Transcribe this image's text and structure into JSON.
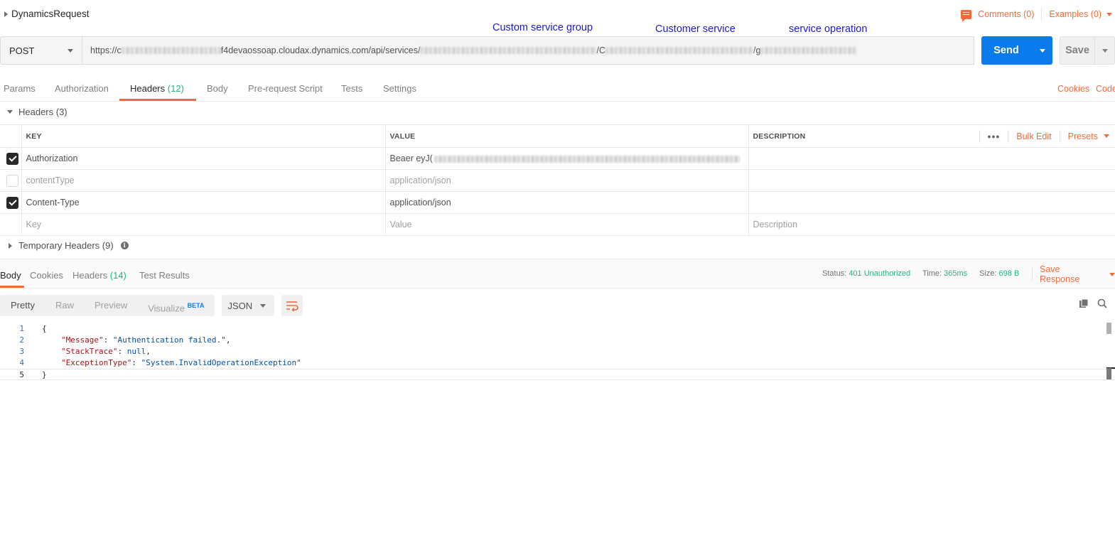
{
  "request": {
    "name": "DynamicsRequest",
    "comments_label": "Comments (0)",
    "examples_label": "Examples (0)",
    "method": "POST",
    "url_prefix": "https://c",
    "url_host_suffix": "f4devaossoap.cloudax.dynamics.com/api/services/",
    "url_sep1": "/C",
    "url_sep2": "/g",
    "send_label": "Send",
    "save_label": "Save"
  },
  "annotations": {
    "group": "Custom service group",
    "service": "Customer service",
    "operation": "service operation"
  },
  "request_tabs": {
    "params": "Params",
    "authorization": "Authorization",
    "headers": "Headers",
    "headers_count": "(12)",
    "body": "Body",
    "prerequest": "Pre-request Script",
    "tests": "Tests",
    "settings": "Settings",
    "cookies": "Cookies",
    "code": "Code"
  },
  "headers_section": {
    "title": "Headers (3)",
    "columns": {
      "key": "KEY",
      "value": "VALUE",
      "description": "DESCRIPTION"
    },
    "bulk_edit": "Bulk Edit",
    "presets": "Presets",
    "rows": [
      {
        "checked": true,
        "key": "Authorization",
        "value": "Beaer eyJ("
      },
      {
        "checked": false,
        "key": "contentType",
        "value": "application/json"
      },
      {
        "checked": true,
        "key": "Content-Type",
        "value": "application/json"
      }
    ],
    "placeholder": {
      "key": "Key",
      "value": "Value",
      "description": "Description"
    },
    "temporary": "Temporary Headers (9)"
  },
  "response": {
    "tabs": {
      "body": "Body",
      "cookies": "Cookies",
      "headers": "Headers",
      "headers_count": "(14)",
      "test_results": "Test Results"
    },
    "status_label": "Status:",
    "status_value": "401 Unauthorized",
    "time_label": "Time:",
    "time_value": "365ms",
    "size_label": "Size:",
    "size_value": "698 B",
    "save_response": "Save Response",
    "format": {
      "pretty": "Pretty",
      "raw": "Raw",
      "preview": "Preview",
      "visualize": "Visualize",
      "beta": "BETA",
      "language": "JSON"
    },
    "code_lines": [
      {
        "n": "1",
        "text": "{"
      },
      {
        "n": "2",
        "key": "\"Message\"",
        "val": "\"Authentication failed.\"",
        "tail": ","
      },
      {
        "n": "3",
        "key": "\"StackTrace\"",
        "val": "null",
        "tail": ","
      },
      {
        "n": "4",
        "key": "\"ExceptionType\"",
        "val": "\"System.InvalidOperationException\"",
        "tail": ""
      },
      {
        "n": "5",
        "text": "}"
      }
    ]
  },
  "colors": {
    "accent": "#f26b3a",
    "send_blue": "#097bed",
    "success_green": "#26b47f",
    "annotation_blue": "#1a1ad6"
  }
}
